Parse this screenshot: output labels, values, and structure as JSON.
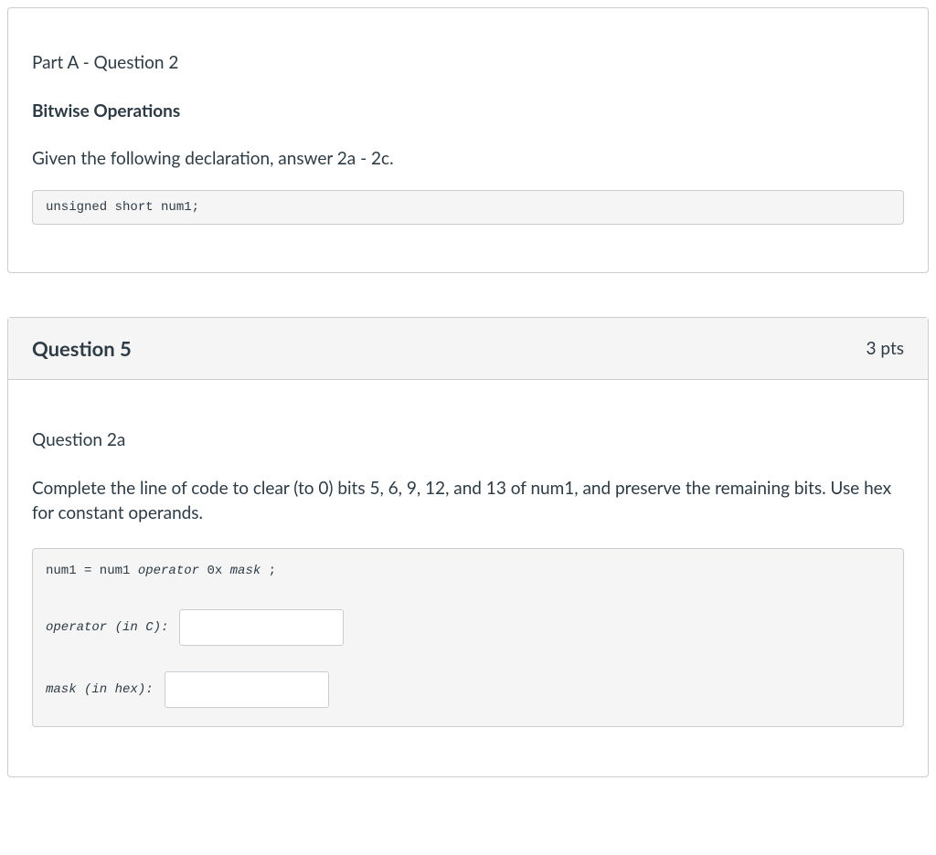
{
  "context_card": {
    "part_title": "Part A - Question 2",
    "section_title": "Bitwise Operations",
    "context_text": "Given the following declaration, answer 2a - 2c.",
    "code": "unsigned short num1;"
  },
  "question_card": {
    "header": {
      "number": "Question 5",
      "points": "3 pts"
    },
    "subq_title": "Question 2a",
    "prompt": "Complete the line of code to clear (to 0) bits 5, 6, 9, 12, and 13 of num1, and preserve the remaining bits. Use hex for constant operands.",
    "expression": {
      "prefix": "num1 = num1 ",
      "operator_word": "operator",
      "mid": " 0x ",
      "mask_word": "mask",
      "suffix": " ;"
    },
    "fields": {
      "operator_label": "operator (in C):",
      "operator_value": "",
      "mask_label": "mask (in hex):",
      "mask_value": ""
    }
  }
}
